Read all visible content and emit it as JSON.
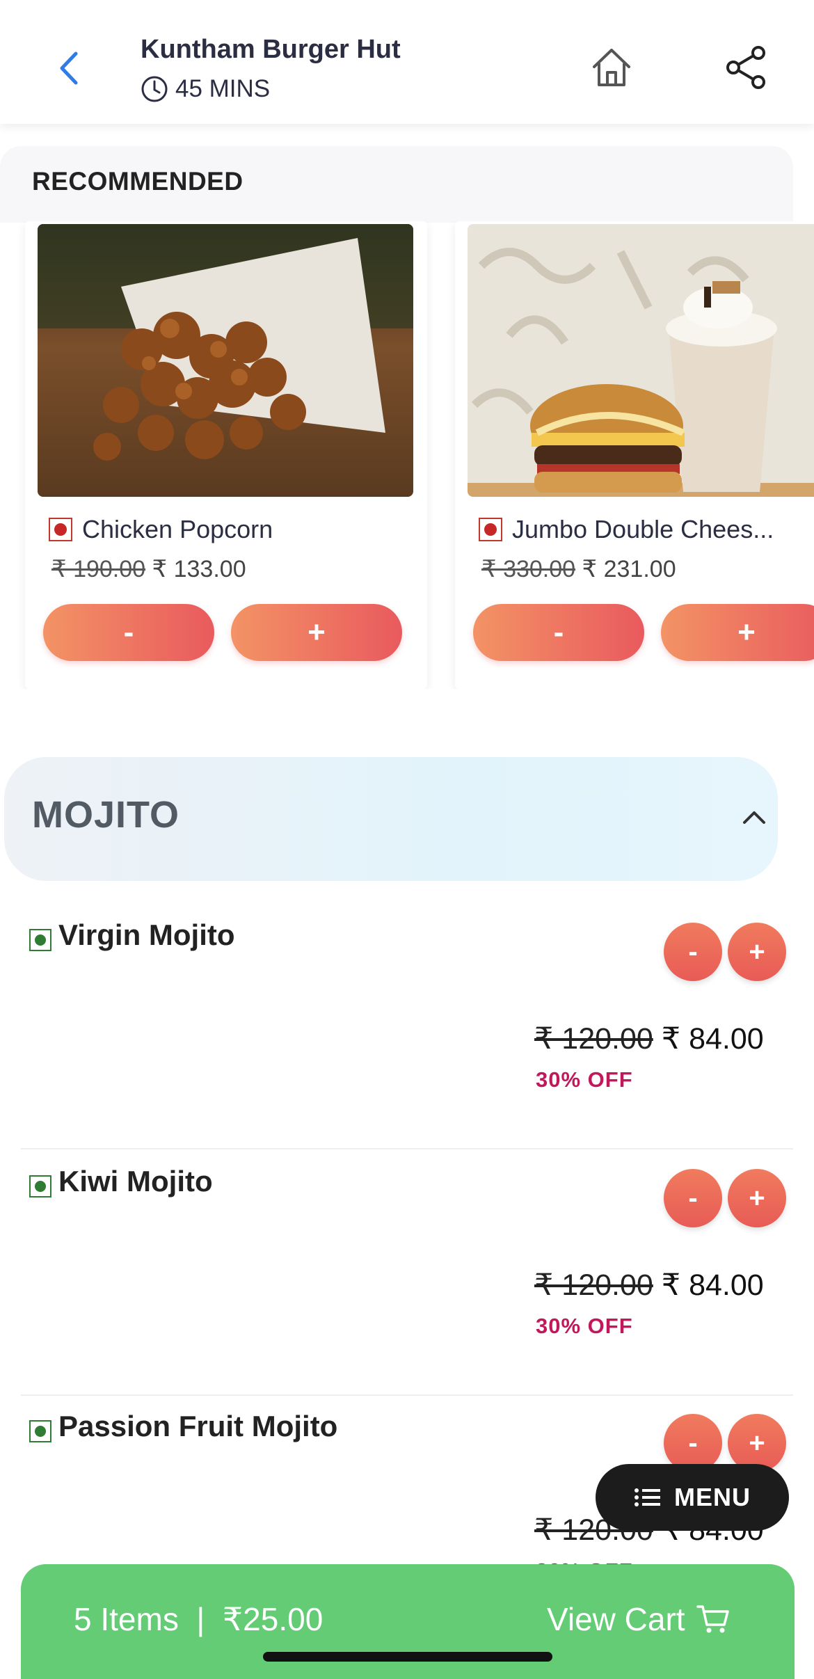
{
  "header": {
    "title": "Kuntham Burger Hut",
    "eta": "45 MINS"
  },
  "recommended": {
    "title": "RECOMMENDED",
    "items": [
      {
        "name": "Chicken Popcorn",
        "original_price": "₹ 190.00",
        "price": "₹ 133.00",
        "minus_label": "-",
        "plus_label": "+"
      },
      {
        "name": "Jumbo Double Chees...",
        "original_price": "₹ 330.00",
        "price": "₹ 231.00",
        "minus_label": "-",
        "plus_label": "+"
      }
    ]
  },
  "category": {
    "label": "MOJITO"
  },
  "items": [
    {
      "name": "Virgin Mojito",
      "original_price": "₹ 120.00",
      "price": "₹ 84.00",
      "discount": "30% OFF",
      "minus_label": "-",
      "plus_label": "+"
    },
    {
      "name": "Kiwi Mojito",
      "original_price": "₹ 120.00",
      "price": "₹ 84.00",
      "discount": "30% OFF",
      "minus_label": "-",
      "plus_label": "+"
    },
    {
      "name": "Passion Fruit Mojito",
      "original_price": "₹ 120.00",
      "price": "₹ 84.00",
      "discount": "30% OFF",
      "minus_label": "-",
      "plus_label": "+"
    }
  ],
  "menu_button": {
    "label": "MENU"
  },
  "cart": {
    "summary": "5 Items  |  ₹25.00",
    "action": "View Cart"
  },
  "colors": {
    "accent_gradient_start": "#f39365",
    "accent_gradient_end": "#e95a5e",
    "cart_green": "#63cc74",
    "discount_red": "#c2185b",
    "back_blue": "#2f7ce6"
  },
  "icons": {
    "back": "chevron-left-icon",
    "eta": "clock-icon",
    "home": "home-icon",
    "share": "share-icon",
    "collapse": "chevron-up-icon",
    "menu": "list-icon",
    "cart": "cart-icon"
  }
}
